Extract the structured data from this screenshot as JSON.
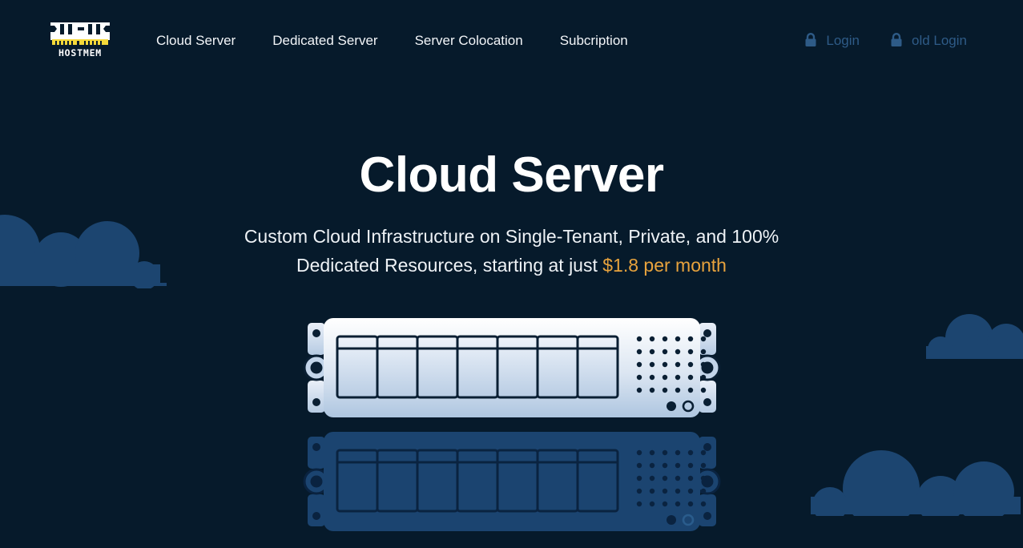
{
  "brand": {
    "name": "HOSTMEM",
    "logo_icon": "ram-memory-module-icon"
  },
  "nav": {
    "items": [
      {
        "label": "Cloud Server"
      },
      {
        "label": "Dedicated Server"
      },
      {
        "label": "Server Colocation"
      },
      {
        "label": "Subcription"
      }
    ]
  },
  "auth": {
    "icon": "lock-icon",
    "login_label": "Login",
    "old_login_label": "old Login"
  },
  "hero": {
    "title": "Cloud Server",
    "subtitle_line1": "Custom Cloud Infrastructure on Single-Tenant, Private, and",
    "subtitle_line2_before": "100% Dedicated Resources, starting at just ",
    "price": "$1.8 per month"
  },
  "illustration": {
    "name": "rack-server-illustration",
    "units": [
      {
        "name": "server-unit-light",
        "style": "light",
        "bays": 7,
        "vent_cols": 6,
        "vent_rows": 5,
        "leds": 2
      },
      {
        "name": "server-unit-dark",
        "style": "dark",
        "bays": 7,
        "vent_cols": 6,
        "vent_rows": 5,
        "leds": 2
      }
    ]
  },
  "decor": {
    "clouds": [
      "cloud-left",
      "cloud-right-upper",
      "cloud-right-lower"
    ]
  },
  "colors": {
    "background": "#061a2b",
    "accent_orange": "#e8a33d",
    "cloud_blue": "#1c4570",
    "server_dark_blue": "#1b4470",
    "auth_text": "#2e5b87",
    "text_white": "#ffffff",
    "logo_yellow": "#f5d93a"
  }
}
